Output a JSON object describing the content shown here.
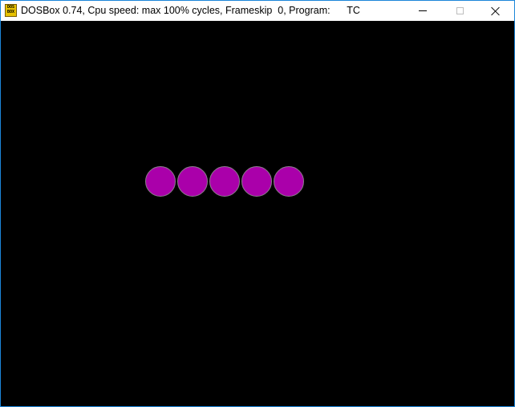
{
  "window": {
    "title": "DOSBox 0.74, Cpu speed: max 100% cycles, Frameskip  0, Program:      TC",
    "icon_text_top": "DOS",
    "icon_text_bottom": "BOX",
    "icon": "dosbox-icon",
    "controls": {
      "minimize_icon": "minimize-icon",
      "maximize_icon": "maximize-icon",
      "close_icon": "close-icon"
    }
  },
  "screen": {
    "background": "#000000",
    "segment_color": "#aa00aa",
    "segment_count": 5
  }
}
